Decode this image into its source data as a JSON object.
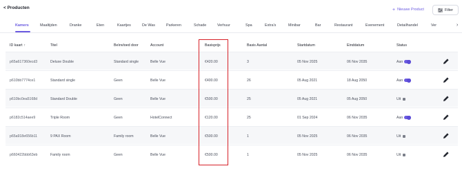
{
  "header": {
    "back_label": "< Producten",
    "new_product_label": "Nieuwe Product",
    "filter_label": "Filter"
  },
  "tabs": [
    {
      "label": "Kamers",
      "active": true
    },
    {
      "label": "Maaltijden"
    },
    {
      "label": "Dranke"
    },
    {
      "label": "Eten"
    },
    {
      "label": "Kaartjes"
    },
    {
      "label": "De Was"
    },
    {
      "label": "Parkeren"
    },
    {
      "label": "Schade"
    },
    {
      "label": "Verhuur"
    },
    {
      "label": "Spa"
    },
    {
      "label": "Extra's"
    },
    {
      "label": "Minibar"
    },
    {
      "label": "Bar"
    },
    {
      "label": "Restaurant"
    },
    {
      "label": "Evenement"
    },
    {
      "label": "Detailhandel"
    },
    {
      "label": "Ver"
    }
  ],
  "columns": [
    "ID kaart",
    "Titel",
    "Beïnvloed door",
    "Account",
    "Basisprijs",
    "Basis Aantal",
    "Startdatum",
    "Einddatum",
    "Status"
  ],
  "sort_icon": "↑",
  "rows": [
    {
      "id": "p65a617360ecd3",
      "title": "Deluxe Double",
      "influenced_by": "Standard single",
      "account": "Belle Vue",
      "price": "€420.00",
      "qty": "3",
      "start": "05 Nov 2025",
      "end": "06 Nov 2035",
      "status": "Aan",
      "status_on": true
    },
    {
      "id": "p610bb7774ce1",
      "title": "Standard single",
      "influenced_by": "Geen",
      "account": "Belle Vue",
      "price": "€400.00",
      "qty": "26",
      "start": "05 Aug 2021",
      "end": "18 Aug 2050",
      "status": "Aan",
      "status_on": true
    },
    {
      "id": "p610bc0ea5168d",
      "title": "Standard Double",
      "influenced_by": "Geen",
      "account": "Belle Vue",
      "price": "€500.00",
      "qty": "25",
      "start": "05 Aug 2021",
      "end": "05 Aug 2050",
      "status": "Uit",
      "status_on": false
    },
    {
      "id": "p6182c514aee9",
      "title": "Triple Room",
      "influenced_by": "Geen",
      "account": "HotelConnect",
      "price": "€120.00",
      "qty": "25",
      "start": "01 Sep 2024",
      "end": "06 Nov 2035",
      "status": "Aan",
      "status_on": true
    },
    {
      "id": "p65a918e656b11",
      "title": "9 PAX Room",
      "influenced_by": "Family room",
      "account": "Belle Vue",
      "price": "€500.00",
      "qty": "1",
      "start": "05 Nov 2025",
      "end": "06 Nov 2035",
      "status": "Uit",
      "status_on": false
    },
    {
      "id": "p660422bbb63eb",
      "title": "Family room",
      "influenced_by": "Geen",
      "account": "Belle Vue",
      "price": "€500.00",
      "qty": "1",
      "start": "05 Nov 2025",
      "end": "06 Nov 2035",
      "status": "Uit",
      "status_on": false
    }
  ],
  "colors": {
    "accent": "#6a5ae0",
    "highlight": "#d61f26"
  }
}
